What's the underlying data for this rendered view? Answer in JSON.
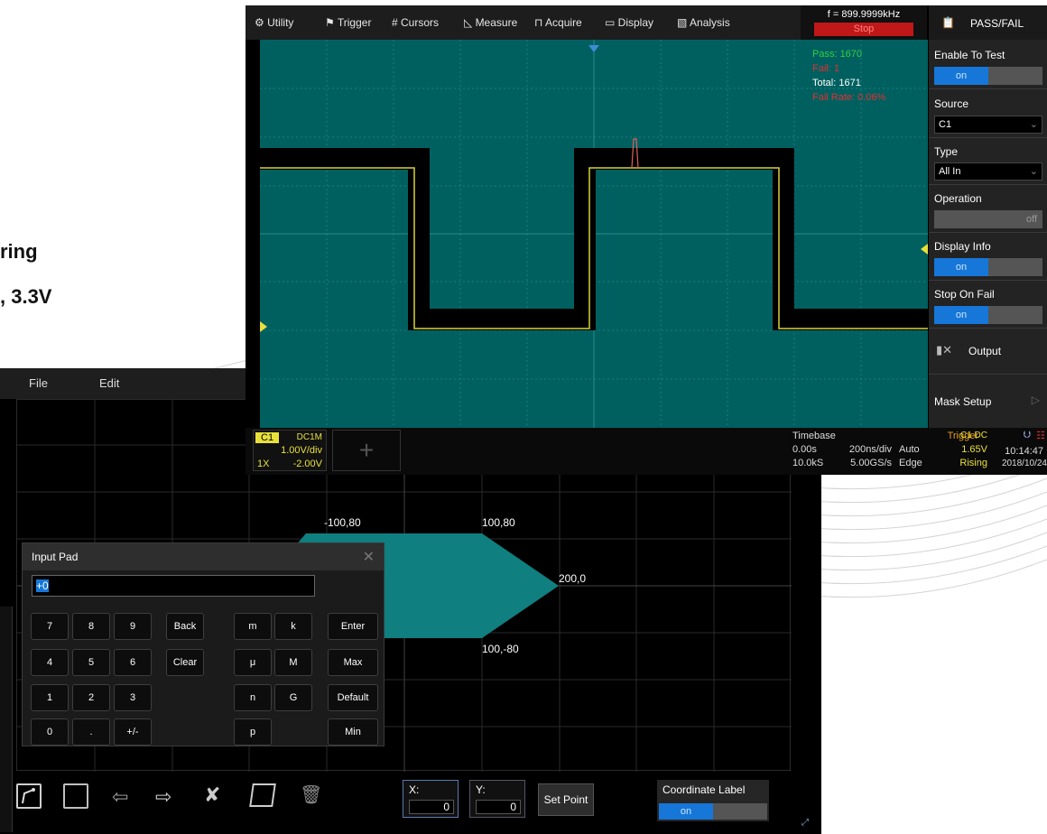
{
  "background": {
    "line1": "ring",
    "line2": ", 3.3V"
  },
  "editor": {
    "menu": {
      "file": "File",
      "edit": "Edit"
    },
    "points": [
      {
        "label": "-100,80"
      },
      {
        "label": "100,80"
      },
      {
        "label": "200,0"
      },
      {
        "label": "100,-80"
      }
    ],
    "x_label": "X:",
    "x_value": "0",
    "y_label": "Y:",
    "y_value": "0",
    "set_point": "Set Point",
    "coord_label_title": "Coordinate Label",
    "coord_label_state": "on",
    "colors": {
      "mask": "#0f7f7f",
      "accent": "#1677d9"
    }
  },
  "input_pad": {
    "title": "Input Pad",
    "value": "+0",
    "keys": {
      "k7": "7",
      "k8": "8",
      "k9": "9",
      "back": "Back",
      "m": "m",
      "k": "k",
      "enter": "Enter",
      "k4": "4",
      "k5": "5",
      "k6": "6",
      "clear": "Clear",
      "mu": "μ",
      "M": "M",
      "max": "Max",
      "k1": "1",
      "k2": "2",
      "k3": "3",
      "n": "n",
      "G": "G",
      "default": "Default",
      "k0": "0",
      "dot": ".",
      "pm": "+/-",
      "p": "p",
      "min": "Min"
    }
  },
  "scope": {
    "menu": {
      "utility": "Utility",
      "trigger": "Trigger",
      "cursors": "Cursors",
      "measure": "Measure",
      "acquire": "Acquire",
      "display": "Display",
      "analysis": "Analysis"
    },
    "frequency": "f = 899.9999kHz",
    "run_state": "Stop",
    "stats": {
      "pass": "Pass: 1670",
      "fail": "Fail: 1",
      "total": "Total: 1671",
      "fail_rate": "Fail Rate: 0.06%"
    },
    "panel": {
      "title": "PASS/FAIL",
      "enable_to_test": "Enable To Test",
      "enable_state": "on",
      "source": "Source",
      "source_value": "C1",
      "type": "Type",
      "type_value": "All In",
      "operation": "Operation",
      "operation_state": "off",
      "display_info": "Display Info",
      "display_info_state": "on",
      "stop_on_fail": "Stop On Fail",
      "stop_on_fail_state": "on",
      "output": "Output",
      "mask_setup": "Mask Setup"
    },
    "status": {
      "channel": "C1",
      "coupling": "DC1M",
      "vdiv": "1.00V/div",
      "probe": "1X",
      "offset": "-2.00V",
      "timebase_label": "Timebase",
      "trigger_label": "Trigger",
      "trig_src": "C1 DC",
      "delay": "0.00s",
      "tdiv": "200ns/div",
      "trig_mode": "Auto",
      "trig_level": "1.65V",
      "mem": "10.0kS",
      "srate": "5.00GS/s",
      "trig_type": "Edge",
      "slope": "Rising",
      "time": "10:14:47",
      "date": "2018/10/24"
    },
    "colors": {
      "trace": "#d8d23a",
      "screen": "#006060",
      "accent": "#1677d9",
      "fail": "#e03030",
      "pass": "#30d040"
    }
  }
}
